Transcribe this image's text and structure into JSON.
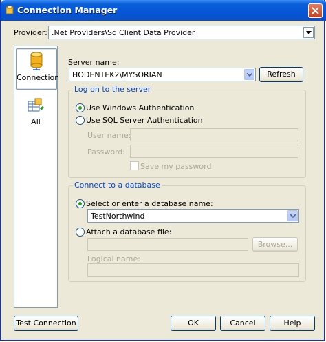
{
  "window": {
    "title": "Connection Manager"
  },
  "provider": {
    "label": "Provider:",
    "value": ".Net Providers\\SqlClient Data Provider"
  },
  "sidebar": {
    "items": [
      {
        "label": "Connection",
        "icon": "database-cylinder-icon"
      },
      {
        "label": "All",
        "icon": "properties-grid-icon"
      }
    ]
  },
  "server": {
    "label": "Server name:",
    "value": "HODENTEK2\\MYSORIAN",
    "refresh_label": "Refresh"
  },
  "logon": {
    "title": "Log on to the server",
    "windows_auth": "Use Windows Authentication",
    "sql_auth": "Use SQL Server Authentication",
    "user_label": "User name:",
    "password_label": "Password:",
    "save_password": "Save my password",
    "selected": "windows"
  },
  "database": {
    "title": "Connect to a database",
    "select_label": "Select or enter a database name:",
    "db_value": "TestNorthwind",
    "attach_label": "Attach a database file:",
    "browse_label": "Browse...",
    "logical_label": "Logical name:",
    "selected": "select"
  },
  "buttons": {
    "test": "Test Connection",
    "ok": "OK",
    "cancel": "Cancel",
    "help": "Help"
  },
  "colors": {
    "titlebar": "#0556d6",
    "accent_text": "#0046d5",
    "face": "#ece9d8",
    "radio_dot": "#21a121"
  }
}
